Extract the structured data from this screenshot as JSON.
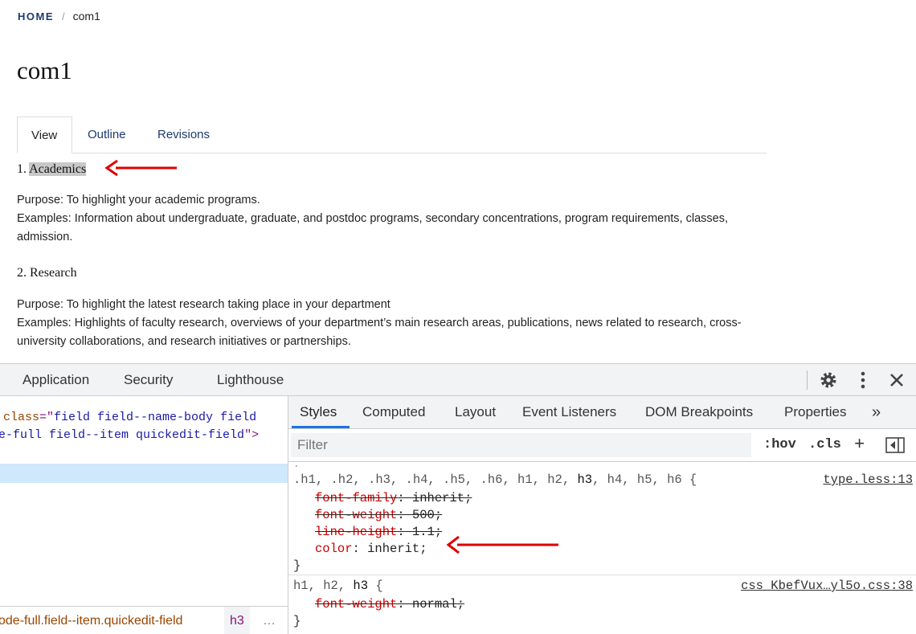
{
  "breadcrumb": {
    "home": "Home",
    "separator": "/",
    "current": "com1"
  },
  "page_title": "com1",
  "tabs": [
    {
      "label": "View"
    },
    {
      "label": "Outline"
    },
    {
      "label": "Revisions"
    }
  ],
  "content": {
    "sections": [
      {
        "number": "1.",
        "title": "Academics",
        "purpose": "Purpose: To highlight your academic programs.",
        "examples": "Examples: Information about undergraduate, graduate, and postdoc programs, secondary concentrations, program requirements, classes, admission."
      },
      {
        "number": "2.",
        "title": "Research",
        "purpose": "Purpose: To highlight the latest research taking place in your department",
        "examples": "Examples: Highlights of faculty research, overviews of your department’s main research areas, publications, news related to research, cross-university collaborations, and research initiatives or partnerships."
      }
    ]
  },
  "devtools": {
    "top_tabs": [
      "Application",
      "Security",
      "Lighthouse"
    ],
    "icons": [
      "gear-icon",
      "kebab-menu-icon",
      "close-icon"
    ],
    "elements": {
      "line1": {
        "attr": "class",
        "eq": "=\"",
        "value": "field field--name-body field"
      },
      "line2": {
        "value": "e-full field--item quickedit-field",
        "close": "\">"
      },
      "breadcrumb_path": "ode-full.field--item.quickedit-field",
      "breadcrumb_tag": "h3",
      "breadcrumb_more": "…"
    },
    "styles_tabs": [
      "Styles",
      "Computed",
      "Layout",
      "Event Listeners",
      "DOM Breakpoints",
      "Properties",
      "»"
    ],
    "filter_placeholder": "Filter",
    "filter_buttons": {
      "hov": ":hov",
      "cls": ".cls",
      "add": "+"
    },
    "rules": [
      {
        "selector_pre": ".h1, .h2, .h3, .h4, .h5, .h6, h1, h2, ",
        "selector_match": "h3",
        "selector_post": ", h4, h5, h6 {",
        "source": "type.less:13",
        "declarations": [
          {
            "name": "font-family",
            "value": "inherit",
            "struck": true
          },
          {
            "name": "font-weight",
            "value": "500",
            "struck": true
          },
          {
            "name": "line-height",
            "value": "1.1",
            "struck": true
          },
          {
            "name": "color",
            "value": "inherit",
            "struck": false
          }
        ],
        "close": "}"
      },
      {
        "selector_pre": "h1, h2, ",
        "selector_match": "h3",
        "selector_post": " {",
        "source": "css_KbefVux…yl5o.css:38",
        "declarations": [
          {
            "name": "font-weight",
            "value": "normal",
            "struck": true
          }
        ],
        "close": "}"
      }
    ]
  },
  "colors": {
    "link": "#1d3a6e",
    "annotation_arrow": "#e00000",
    "highlight": "#c8c8c8",
    "devtools_accent": "#1a73e8"
  }
}
